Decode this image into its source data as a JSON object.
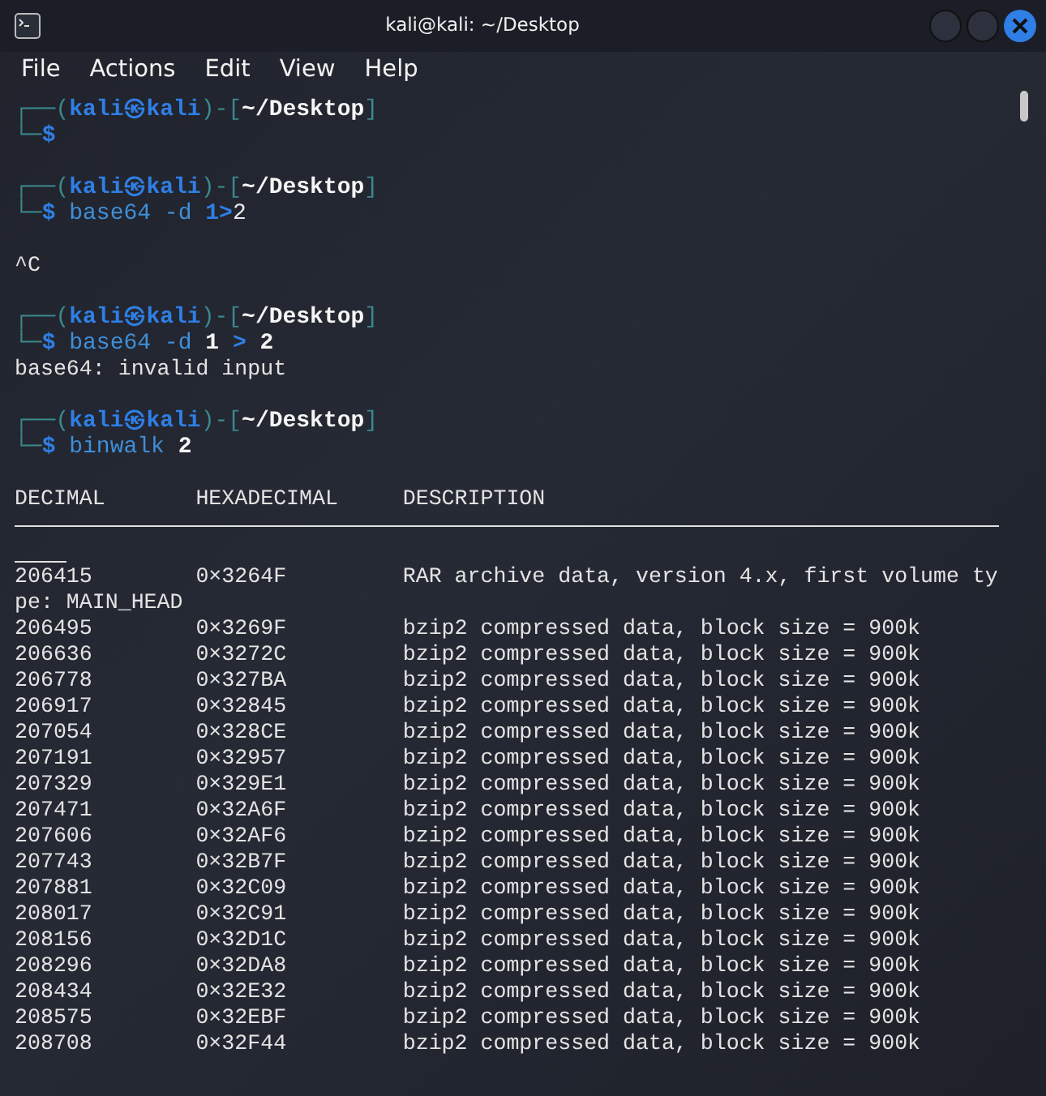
{
  "window": {
    "title": "kali@kali: ~/Desktop"
  },
  "menu": [
    "File",
    "Actions",
    "Edit",
    "View",
    "Help"
  ],
  "terminal": {
    "lines": [
      {
        "kind": "prompt",
        "parts": [
          {
            "text": "┌──(",
            "kind": "frame"
          },
          {
            "text": "kali㉿kali",
            "kind": "user"
          },
          {
            "text": ")-[",
            "kind": "frame"
          },
          {
            "text": "~/Desktop",
            "kind": "path"
          },
          {
            "text": "]",
            "kind": "frame"
          }
        ]
      },
      {
        "kind": "command",
        "parts": [
          {
            "text": "└─",
            "kind": "frame"
          },
          {
            "text": "$",
            "kind": "user"
          }
        ]
      },
      {
        "kind": "blank"
      },
      {
        "kind": "prompt",
        "parts": [
          {
            "text": "┌──(",
            "kind": "frame"
          },
          {
            "text": "kali㉿kali",
            "kind": "user"
          },
          {
            "text": ")-[",
            "kind": "frame"
          },
          {
            "text": "~/Desktop",
            "kind": "path"
          },
          {
            "text": "]",
            "kind": "frame"
          }
        ]
      },
      {
        "kind": "command",
        "parts": [
          {
            "text": "└─",
            "kind": "frame"
          },
          {
            "text": "$",
            "kind": "user"
          },
          {
            "text": " base64 -d ",
            "kind": "command"
          },
          {
            "text": "1>",
            "kind": "redirect"
          },
          {
            "text": "2",
            "kind": "arg"
          }
        ]
      },
      {
        "kind": "blank"
      },
      {
        "kind": "output",
        "text": "^C"
      },
      {
        "kind": "blank"
      },
      {
        "kind": "prompt",
        "parts": [
          {
            "text": "┌──(",
            "kind": "frame"
          },
          {
            "text": "kali㉿kali",
            "kind": "user"
          },
          {
            "text": ")-[",
            "kind": "frame"
          },
          {
            "text": "~/Desktop",
            "kind": "path"
          },
          {
            "text": "]",
            "kind": "frame"
          }
        ]
      },
      {
        "kind": "command",
        "parts": [
          {
            "text": "└─",
            "kind": "frame"
          },
          {
            "text": "$",
            "kind": "user"
          },
          {
            "text": " base64 -d ",
            "kind": "command"
          },
          {
            "text": "1",
            "kind": "boldarg"
          },
          {
            "text": " > ",
            "kind": "redirect"
          },
          {
            "text": "2",
            "kind": "boldarg"
          }
        ]
      },
      {
        "kind": "output",
        "text": "base64: invalid input"
      },
      {
        "kind": "blank"
      },
      {
        "kind": "prompt",
        "parts": [
          {
            "text": "┌──(",
            "kind": "frame"
          },
          {
            "text": "kali㉿kali",
            "kind": "user"
          },
          {
            "text": ")-[",
            "kind": "frame"
          },
          {
            "text": "~/Desktop",
            "kind": "path"
          },
          {
            "text": "]",
            "kind": "frame"
          }
        ]
      },
      {
        "kind": "command",
        "parts": [
          {
            "text": "└─",
            "kind": "frame"
          },
          {
            "text": "$",
            "kind": "user"
          },
          {
            "text": " binwalk ",
            "kind": "command"
          },
          {
            "text": "2",
            "kind": "boldarg"
          }
        ]
      },
      {
        "kind": "blank"
      },
      {
        "kind": "columns",
        "cells": [
          "DECIMAL",
          "HEXADECIMAL",
          "DESCRIPTION"
        ]
      },
      {
        "kind": "rule"
      },
      {
        "kind": "rule_end"
      },
      {
        "kind": "row",
        "cells": [
          "206415",
          "0×3264F",
          "RAR archive data, version 4.x, first volume ty"
        ]
      },
      {
        "kind": "output",
        "text": "pe: MAIN_HEAD"
      },
      {
        "kind": "row",
        "cells": [
          "206495",
          "0×3269F",
          "bzip2 compressed data, block size = 900k"
        ]
      },
      {
        "kind": "row",
        "cells": [
          "206636",
          "0×3272C",
          "bzip2 compressed data, block size = 900k"
        ]
      },
      {
        "kind": "row",
        "cells": [
          "206778",
          "0×327BA",
          "bzip2 compressed data, block size = 900k"
        ]
      },
      {
        "kind": "row",
        "cells": [
          "206917",
          "0×32845",
          "bzip2 compressed data, block size = 900k"
        ]
      },
      {
        "kind": "row",
        "cells": [
          "207054",
          "0×328CE",
          "bzip2 compressed data, block size = 900k"
        ]
      },
      {
        "kind": "row",
        "cells": [
          "207191",
          "0×32957",
          "bzip2 compressed data, block size = 900k"
        ]
      },
      {
        "kind": "row",
        "cells": [
          "207329",
          "0×329E1",
          "bzip2 compressed data, block size = 900k"
        ]
      },
      {
        "kind": "row",
        "cells": [
          "207471",
          "0×32A6F",
          "bzip2 compressed data, block size = 900k"
        ]
      },
      {
        "kind": "row",
        "cells": [
          "207606",
          "0×32AF6",
          "bzip2 compressed data, block size = 900k"
        ]
      },
      {
        "kind": "row",
        "cells": [
          "207743",
          "0×32B7F",
          "bzip2 compressed data, block size = 900k"
        ]
      },
      {
        "kind": "row",
        "cells": [
          "207881",
          "0×32C09",
          "bzip2 compressed data, block size = 900k"
        ]
      },
      {
        "kind": "row",
        "cells": [
          "208017",
          "0×32C91",
          "bzip2 compressed data, block size = 900k"
        ]
      },
      {
        "kind": "row",
        "cells": [
          "208156",
          "0×32D1C",
          "bzip2 compressed data, block size = 900k"
        ]
      },
      {
        "kind": "row",
        "cells": [
          "208296",
          "0×32DA8",
          "bzip2 compressed data, block size = 900k"
        ]
      },
      {
        "kind": "row",
        "cells": [
          "208434",
          "0×32E32",
          "bzip2 compressed data, block size = 900k"
        ]
      },
      {
        "kind": "row",
        "cells": [
          "208575",
          "0×32EBF",
          "bzip2 compressed data, block size = 900k"
        ]
      },
      {
        "kind": "row",
        "cells": [
          "208708",
          "0×32F44",
          "bzip2 compressed data, block size = 900k"
        ]
      }
    ]
  }
}
